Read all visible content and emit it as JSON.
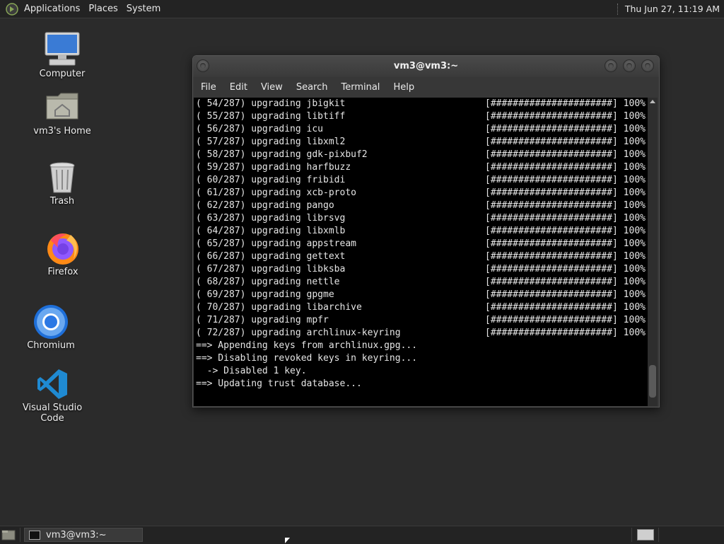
{
  "top_panel": {
    "menus": [
      "Applications",
      "Places",
      "System"
    ],
    "clock": "Thu Jun 27, 11:19 AM"
  },
  "desktop": {
    "icons": [
      {
        "label": "Computer",
        "icon": "computer-icon"
      },
      {
        "label": "vm3's Home",
        "icon": "home-folder-icon"
      },
      {
        "label": "Trash",
        "icon": "trash-icon"
      },
      {
        "label": "Firefox",
        "icon": "firefox-icon"
      },
      {
        "label": "Chromium",
        "icon": "chromium-icon"
      },
      {
        "label": "Visual Studio Code",
        "icon": "vscode-icon"
      }
    ]
  },
  "terminal_window": {
    "title": "vm3@vm3:~",
    "menu": [
      "File",
      "Edit",
      "View",
      "Search",
      "Terminal",
      "Help"
    ],
    "lines": [
      {
        "text": "( 54/287) upgrading jbigkit",
        "bar": "[######################] 100%"
      },
      {
        "text": "( 55/287) upgrading libtiff",
        "bar": "[######################] 100%"
      },
      {
        "text": "( 56/287) upgrading icu",
        "bar": "[######################] 100%"
      },
      {
        "text": "( 57/287) upgrading libxml2",
        "bar": "[######################] 100%"
      },
      {
        "text": "( 58/287) upgrading gdk-pixbuf2",
        "bar": "[######################] 100%"
      },
      {
        "text": "( 59/287) upgrading harfbuzz",
        "bar": "[######################] 100%"
      },
      {
        "text": "( 60/287) upgrading fribidi",
        "bar": "[######################] 100%"
      },
      {
        "text": "( 61/287) upgrading xcb-proto",
        "bar": "[######################] 100%"
      },
      {
        "text": "( 62/287) upgrading pango",
        "bar": "[######################] 100%"
      },
      {
        "text": "( 63/287) upgrading librsvg",
        "bar": "[######################] 100%"
      },
      {
        "text": "( 64/287) upgrading libxmlb",
        "bar": "[######################] 100%"
      },
      {
        "text": "( 65/287) upgrading appstream",
        "bar": "[######################] 100%"
      },
      {
        "text": "( 66/287) upgrading gettext",
        "bar": "[######################] 100%"
      },
      {
        "text": "( 67/287) upgrading libksba",
        "bar": "[######################] 100%"
      },
      {
        "text": "( 68/287) upgrading nettle",
        "bar": "[######################] 100%"
      },
      {
        "text": "( 69/287) upgrading gpgme",
        "bar": "[######################] 100%"
      },
      {
        "text": "( 70/287) upgrading libarchive",
        "bar": "[######################] 100%"
      },
      {
        "text": "( 71/287) upgrading mpfr",
        "bar": "[######################] 100%"
      },
      {
        "text": "( 72/287) upgrading archlinux-keyring",
        "bar": "[######################] 100%"
      },
      {
        "text": "==> Appending keys from archlinux.gpg...",
        "bar": ""
      },
      {
        "text": "==> Disabling revoked keys in keyring...",
        "bar": ""
      },
      {
        "text": "  -> Disabled 1 key.",
        "bar": ""
      },
      {
        "text": "==> Updating trust database...",
        "bar": ""
      }
    ]
  },
  "taskbar": {
    "task_label": "vm3@vm3:~"
  }
}
